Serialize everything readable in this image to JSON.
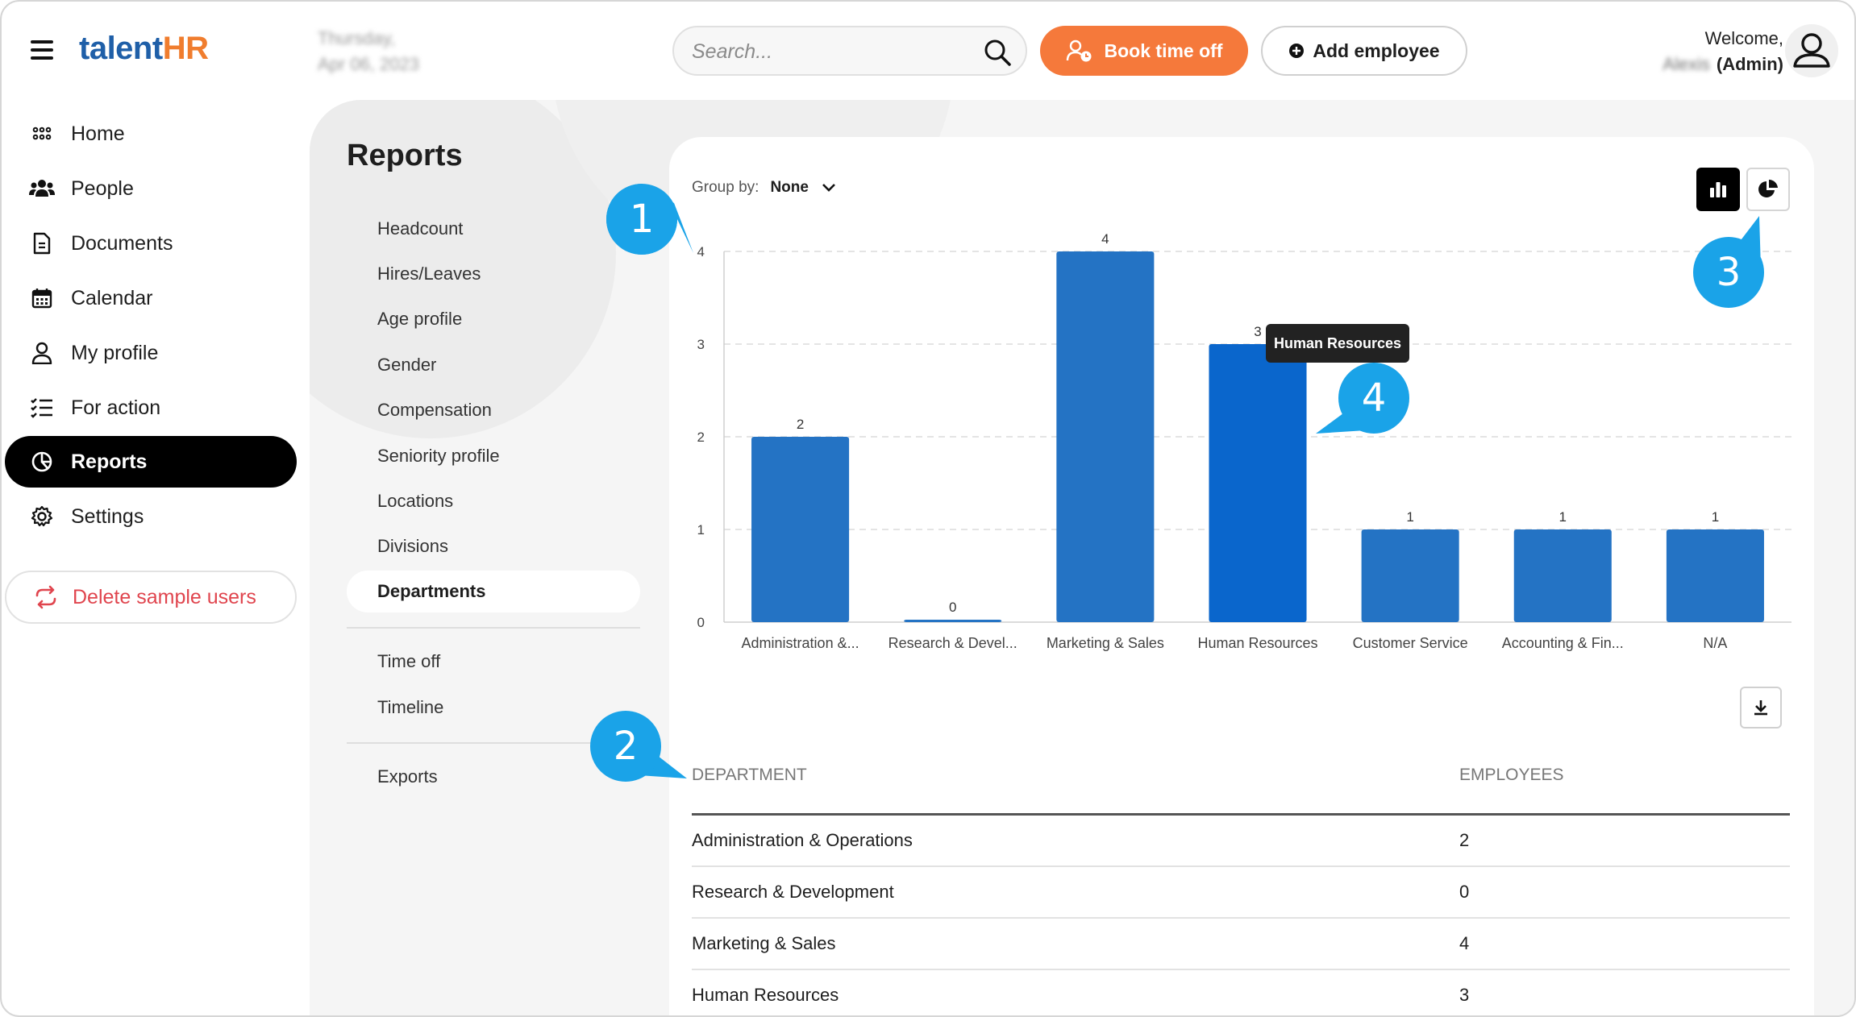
{
  "app": {
    "logo_part1": "talent",
    "logo_part2": "HR",
    "date_line1": "Thursday,",
    "date_line2": "Apr 06, 2023",
    "search_placeholder": "Search...",
    "book_time_off_label": "Book time off",
    "add_employee_label": "Add employee",
    "welcome_label": "Welcome,",
    "user_name": "Alexis",
    "user_role": "(Admin)"
  },
  "sidebar": {
    "items": [
      {
        "label": "Home",
        "icon": "grid-dots-icon"
      },
      {
        "label": "People",
        "icon": "people-icon"
      },
      {
        "label": "Documents",
        "icon": "document-icon"
      },
      {
        "label": "Calendar",
        "icon": "calendar-icon"
      },
      {
        "label": "My profile",
        "icon": "user-icon"
      },
      {
        "label": "For action",
        "icon": "checklist-icon"
      },
      {
        "label": "Reports",
        "icon": "pie-chart-icon",
        "active": true
      },
      {
        "label": "Settings",
        "icon": "gear-icon"
      }
    ],
    "delete_label": "Delete sample users"
  },
  "reports": {
    "title": "Reports",
    "submenu": [
      "Headcount",
      "Hires/Leaves",
      "Age profile",
      "Gender",
      "Compensation",
      "Seniority profile",
      "Locations",
      "Divisions",
      "Departments"
    ],
    "submenu_active": "Departments",
    "submenu2": [
      "Time off",
      "Timeline"
    ],
    "submenu3": [
      "Exports"
    ]
  },
  "controls": {
    "group_by_label": "Group by:",
    "group_by_value": "None"
  },
  "chart_data": {
    "type": "bar",
    "categories": [
      "Administration &...",
      "Research & Devel...",
      "Marketing & Sales",
      "Human Resources",
      "Customer Service",
      "Accounting & Fin...",
      "N/A"
    ],
    "values": [
      2,
      0,
      4,
      3,
      1,
      1,
      1
    ],
    "ylim": [
      0,
      4
    ],
    "yticks": [
      0,
      1,
      2,
      3,
      4
    ],
    "grid": true,
    "highlighted": "Human Resources",
    "bar_color": "#2473c4",
    "highlight_color": "#0a66cc",
    "tooltip": "Human Resources"
  },
  "table": {
    "headers": [
      "DEPARTMENT",
      "EMPLOYEES"
    ],
    "rows": [
      [
        "Administration & Operations",
        "2"
      ],
      [
        "Research & Development",
        "0"
      ],
      [
        "Marketing & Sales",
        "4"
      ],
      [
        "Human Resources",
        "3"
      ]
    ]
  },
  "callouts": [
    "1",
    "2",
    "3",
    "4"
  ],
  "colors": {
    "accent_orange": "#f5793b",
    "callout_blue": "#1aa3e8",
    "delete_red": "#e0454e"
  }
}
